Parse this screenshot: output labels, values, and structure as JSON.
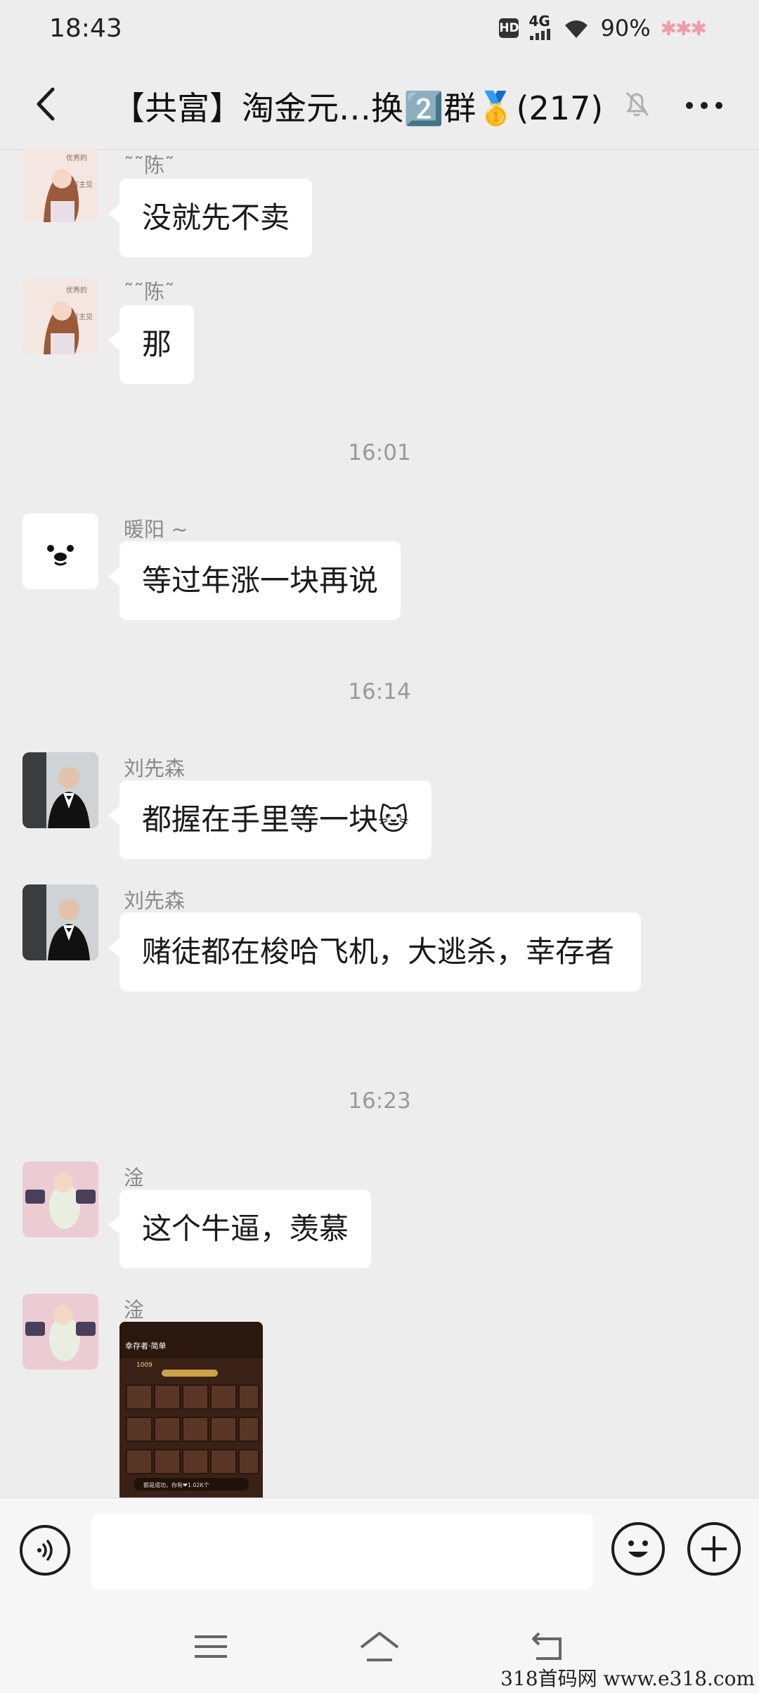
{
  "status_bar": {
    "time": "18:43",
    "network": "4G",
    "battery": "90%",
    "decoration": "✱✱✱"
  },
  "header": {
    "title": "【共富】淘金元…换2️⃣群🥇(217)",
    "back_icon": "back-arrow-icon",
    "mute_icon": "bell-off-icon",
    "more_icon": "more-dots-icon"
  },
  "messages": [
    {
      "sender": "˜˜陈˜",
      "text": "没就先不卖"
    },
    {
      "sender": "˜˜陈˜",
      "text": "那"
    },
    {
      "timestamp": "16:01"
    },
    {
      "sender": "暖阳 ~",
      "text": "等过年涨一块再说"
    },
    {
      "timestamp": "16:14"
    },
    {
      "sender": "刘先森",
      "text": "都握在手里等一块🐱"
    },
    {
      "sender": "刘先森",
      "text": "赌徒都在梭哈飞机，大逃杀，幸存者"
    },
    {
      "timestamp": "16:23"
    },
    {
      "sender": "淦",
      "text": "这个牛逼，羡慕"
    },
    {
      "sender": "淦",
      "image_title": "幸存者·简单",
      "image_count": "1009",
      "image_caption": "都是成功，你有❤1.02K个"
    }
  ],
  "input_bar": {
    "placeholder": ""
  },
  "watermark": "318首码网  www.e318.com",
  "colors": {
    "background": "#ededed",
    "bubble": "#ffffff",
    "accent_icon": "#1c1c1c"
  }
}
